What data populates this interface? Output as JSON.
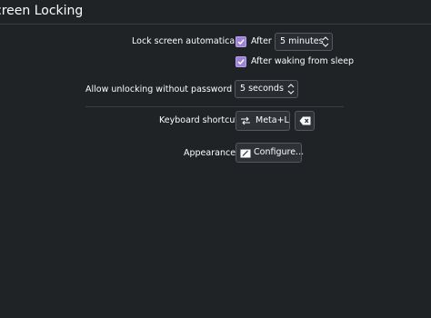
{
  "header": {
    "title": "creen Locking"
  },
  "lock_screen": {
    "label": "Lock screen automatically:",
    "after_label": "After",
    "after_checked": true,
    "timeout_value": "5 minutes",
    "after_sleep_label": "After waking from sleep",
    "after_sleep_checked": true
  },
  "unlock_grace": {
    "label": "Allow unlocking without password for:",
    "value": "5 seconds"
  },
  "shortcut": {
    "label": "Keyboard shortcut:",
    "value": "Meta+L",
    "configure_icon": "shortcut-config-icon",
    "clear_icon": "backspace-clear-icon"
  },
  "appearance": {
    "label": "Appearance:",
    "button_label": "Configure...",
    "button_icon": "edit-icon"
  },
  "colors": {
    "background": "#202326",
    "checkbox_accent": "#9c82d8",
    "text": "#fcfcfc"
  }
}
